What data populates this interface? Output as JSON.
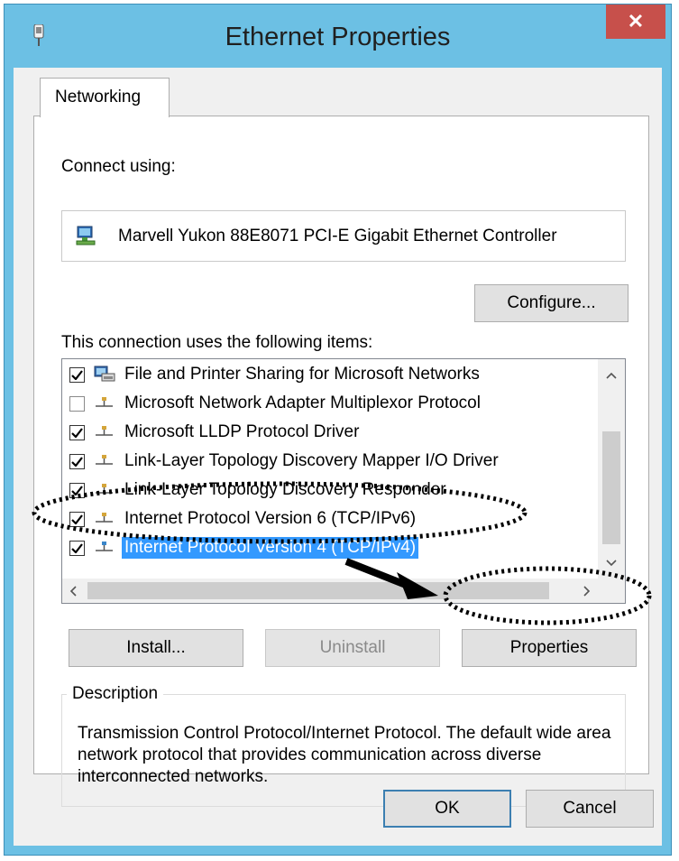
{
  "window": {
    "title": "Ethernet Properties",
    "close_glyph": "✕"
  },
  "tabs": [
    {
      "label": "Networking",
      "active": true
    }
  ],
  "connect_using": {
    "label": "Connect using:",
    "adapter_name": "Marvell Yukon 88E8071 PCI-E Gigabit Ethernet Controller",
    "adapter_icon": "network-adapter-icon"
  },
  "configure_label": "Configure...",
  "items_label": "This connection uses the following items:",
  "items": [
    {
      "label": "File and Printer Sharing for Microsoft Networks",
      "checked": true,
      "icon": "printer-sharing-icon",
      "selected": false
    },
    {
      "label": "Microsoft Network Adapter Multiplexor Protocol",
      "checked": false,
      "icon": "protocol-icon",
      "selected": false
    },
    {
      "label": "Microsoft LLDP Protocol Driver",
      "checked": true,
      "icon": "protocol-icon",
      "selected": false
    },
    {
      "label": "Link-Layer Topology Discovery Mapper I/O Driver",
      "checked": true,
      "icon": "protocol-icon",
      "selected": false
    },
    {
      "label": "Link-Layer Topology Discovery Responder",
      "checked": true,
      "icon": "protocol-icon",
      "selected": false
    },
    {
      "label": "Internet Protocol Version 6 (TCP/IPv6)",
      "checked": true,
      "icon": "protocol-icon",
      "selected": false
    },
    {
      "label": "Internet Protocol Version 4 (TCP/IPv4)",
      "checked": true,
      "icon": "protocol-icon",
      "selected": true
    }
  ],
  "buttons": {
    "install": "Install...",
    "uninstall": "Uninstall",
    "properties": "Properties",
    "ok": "OK",
    "cancel": "Cancel"
  },
  "description": {
    "label": "Description",
    "text": "Transmission Control Protocol/Internet Protocol. The default wide area network protocol that provides communication across diverse interconnected networks."
  },
  "colors": {
    "title_bar": "#6cc0e4",
    "close_button": "#c7504b",
    "selection": "#3399ff"
  }
}
